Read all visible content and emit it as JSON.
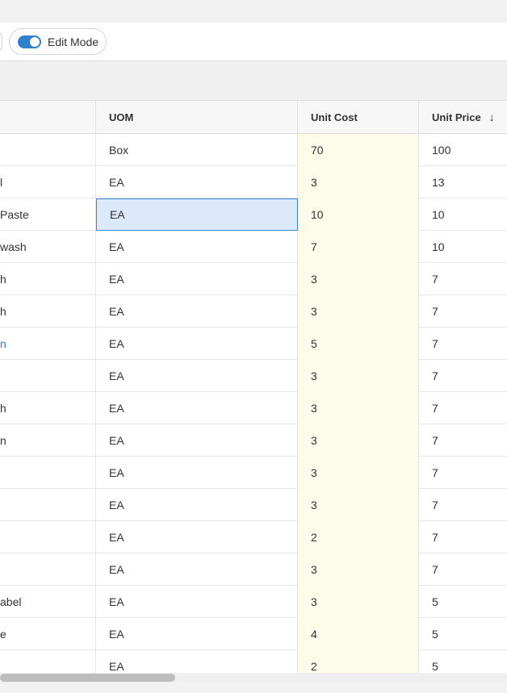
{
  "toolbar": {
    "edit_mode_label": "Edit Mode",
    "edit_mode_on": true,
    "accent_color": "#2f80ce"
  },
  "grid": {
    "columns": [
      {
        "key": "name",
        "label": ""
      },
      {
        "key": "uom",
        "label": "UOM"
      },
      {
        "key": "cost",
        "label": "Unit Cost"
      },
      {
        "key": "price",
        "label": "Unit Price",
        "sort": "descending",
        "sort_icon": "arrow-down-icon"
      }
    ],
    "rows": [
      {
        "name": "",
        "uom": "Box",
        "cost": "70",
        "price": "100"
      },
      {
        "name": "l",
        "uom": "EA",
        "cost": "3",
        "price": "13"
      },
      {
        "name": "Paste",
        "uom": "EA",
        "cost": "10",
        "price": "10",
        "selected_cell": "uom"
      },
      {
        "name": "wash",
        "uom": "EA",
        "cost": "7",
        "price": "10"
      },
      {
        "name": "h",
        "uom": "EA",
        "cost": "3",
        "price": "7"
      },
      {
        "name": "h",
        "uom": "EA",
        "cost": "3",
        "price": "7"
      },
      {
        "name": "n",
        "uom": "EA",
        "cost": "5",
        "price": "7",
        "name_link": true
      },
      {
        "name": "",
        "uom": "EA",
        "cost": "3",
        "price": "7"
      },
      {
        "name": "h",
        "uom": "EA",
        "cost": "3",
        "price": "7"
      },
      {
        "name": "n",
        "uom": "EA",
        "cost": "3",
        "price": "7"
      },
      {
        "name": "",
        "uom": "EA",
        "cost": "3",
        "price": "7"
      },
      {
        "name": "",
        "uom": "EA",
        "cost": "3",
        "price": "7"
      },
      {
        "name": "",
        "uom": "EA",
        "cost": "2",
        "price": "7"
      },
      {
        "name": "",
        "uom": "EA",
        "cost": "3",
        "price": "7"
      },
      {
        "name": "abel",
        "uom": "EA",
        "cost": "3",
        "price": "5"
      },
      {
        "name": "e",
        "uom": "EA",
        "cost": "4",
        "price": "5"
      },
      {
        "name": "",
        "uom": "EA",
        "cost": "2",
        "price": "5"
      }
    ],
    "cost_column_color": "#fdfbe9",
    "selected_cell_color": "#dbe9fa"
  },
  "scrollbar": {
    "horizontal_position": 0
  }
}
